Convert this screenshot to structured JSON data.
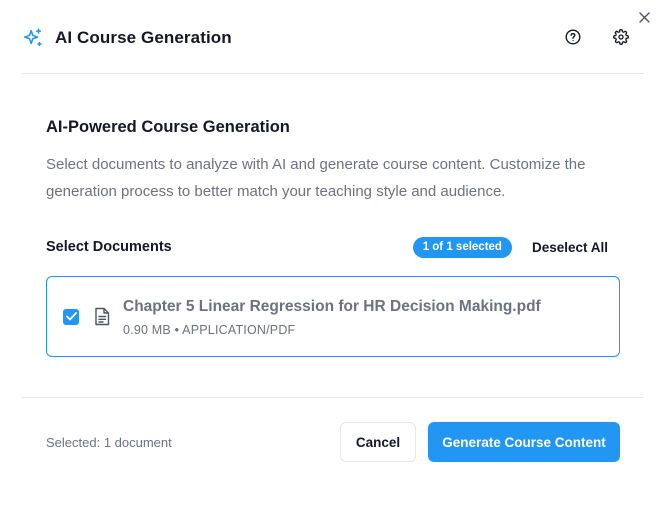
{
  "dialog": {
    "title": "AI Course Generation",
    "title_icon": "sparkles-icon",
    "actions": [
      {
        "name": "help",
        "icon": "help-circle-icon"
      },
      {
        "name": "settings",
        "icon": "gear-icon"
      }
    ],
    "close_icon": "close-icon"
  },
  "intro": {
    "title": "AI-Powered Course Generation",
    "description": "Select documents to analyze with AI and generate course content. Customize the generation process to better match your teaching style and audience."
  },
  "documents": {
    "label": "Select Documents",
    "selection_badge": "1 of 1 selected",
    "deselect_label": "Deselect All",
    "items": [
      {
        "name": "Chapter 5 Linear Regression for HR Decision Making.pdf",
        "meta": "0.90 MB • APPLICATION/PDF",
        "checked": true,
        "icon": "file-text-icon"
      }
    ]
  },
  "footer": {
    "selected_text": "Selected: 1 document",
    "cancel_label": "Cancel",
    "generate_label": "Generate Course Content"
  },
  "colors": {
    "accent": "#2196f3",
    "text_primary": "#111827",
    "text_muted": "#6b7280",
    "border": "#e5e7eb"
  }
}
